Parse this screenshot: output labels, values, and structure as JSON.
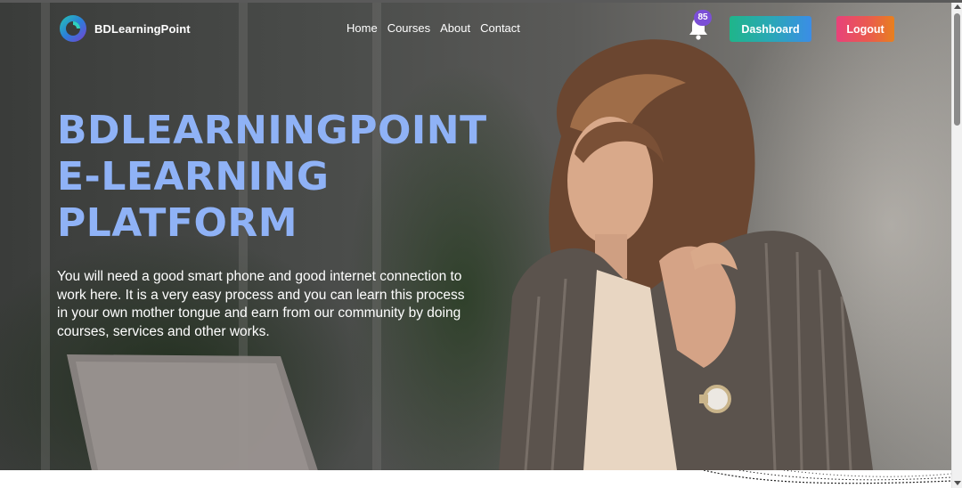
{
  "brand": {
    "name": "BDLearningPoint",
    "logo_icon": "bdlearningpoint-logo-icon"
  },
  "nav": {
    "links": [
      "Home",
      "Courses",
      "About",
      "Contact"
    ]
  },
  "notifications": {
    "icon": "bell-icon",
    "count": "85"
  },
  "buttons": {
    "dashboard": "Dashboard",
    "logout": "Logout"
  },
  "hero": {
    "title_lines": [
      "BDLEARNINGPOINT",
      "E-LEARNING",
      "PLATFORM"
    ],
    "description": "You will need a good smart phone and good internet connection to work here. It is a very easy process and you can learn this process in your own mother tongue and earn from our community by doing courses, services and other works."
  },
  "colors": {
    "title": "#8fb2f6",
    "dashboard_gradient": [
      "#1fb58a",
      "#3b8de6"
    ],
    "logout_gradient": [
      "#e8427a",
      "#e8801e"
    ],
    "badge": "#7b4fd6"
  }
}
